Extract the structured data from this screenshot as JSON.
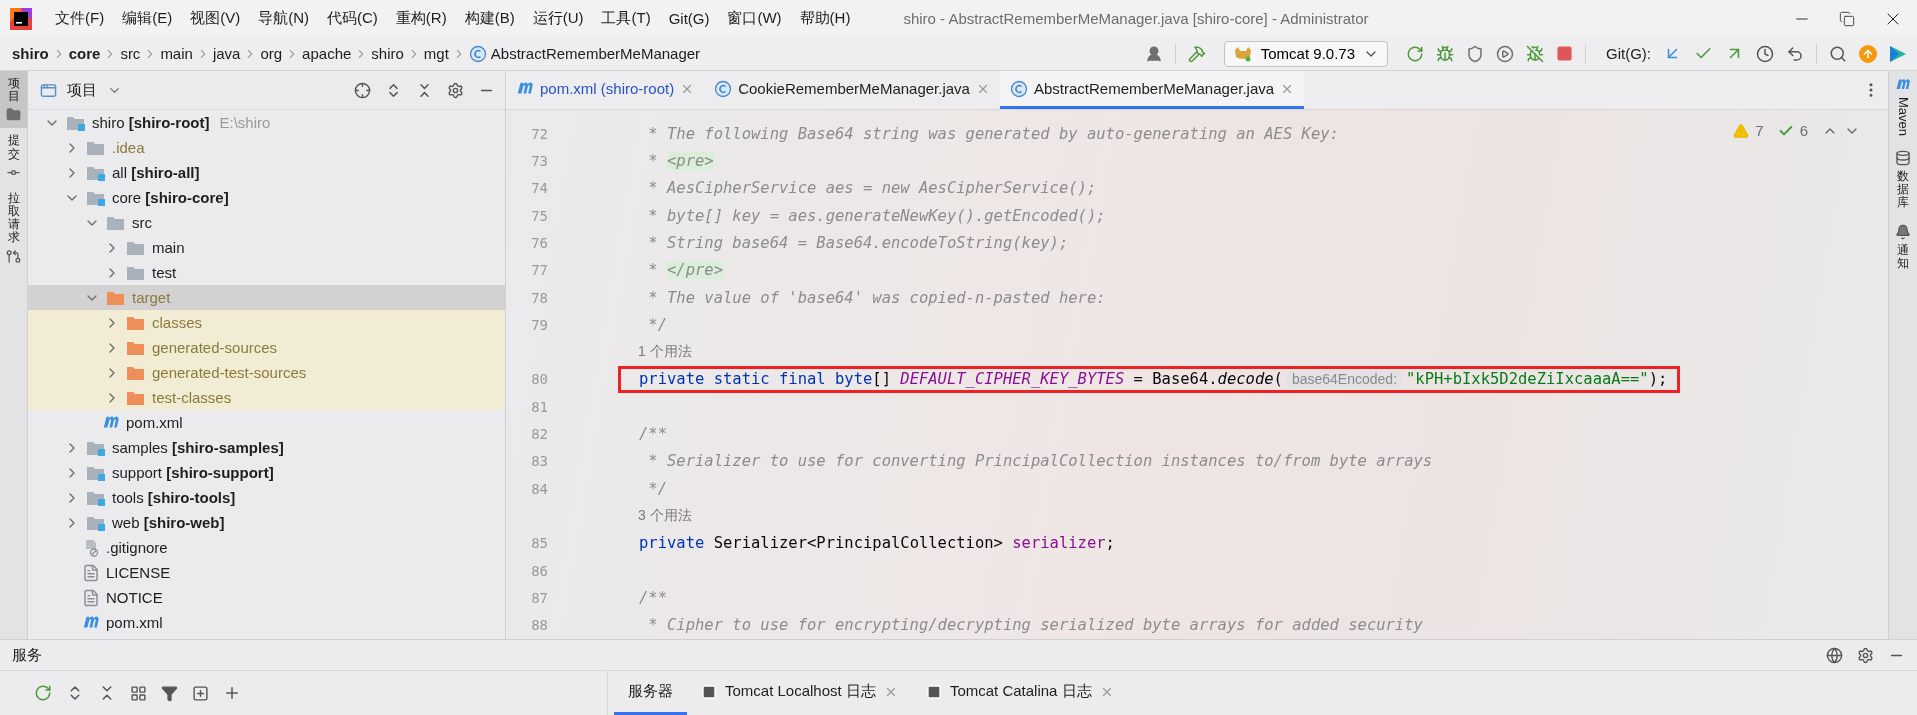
{
  "window": {
    "title": "shiro - AbstractRememberMeManager.java [shiro-core] - Administrator"
  },
  "menu": [
    "文件(F)",
    "编辑(E)",
    "视图(V)",
    "导航(N)",
    "代码(C)",
    "重构(R)",
    "构建(B)",
    "运行(U)",
    "工具(T)",
    "Git(G)",
    "窗口(W)",
    "帮助(H)"
  ],
  "breadcrumb": [
    {
      "label": "shiro",
      "bold": true,
      "kind": "folder"
    },
    {
      "label": "core",
      "bold": true,
      "kind": "folder"
    },
    {
      "label": "src",
      "bold": false,
      "kind": "folder"
    },
    {
      "label": "main",
      "bold": false,
      "kind": "folder"
    },
    {
      "label": "java",
      "bold": false,
      "kind": "folder"
    },
    {
      "label": "org",
      "bold": false,
      "kind": "folder"
    },
    {
      "label": "apache",
      "bold": false,
      "kind": "folder"
    },
    {
      "label": "shiro",
      "bold": false,
      "kind": "folder"
    },
    {
      "label": "mgt",
      "bold": false,
      "kind": "folder"
    },
    {
      "label": "AbstractRememberMeManager",
      "bold": false,
      "kind": "class"
    }
  ],
  "toolbar": {
    "run_config": "Tomcat 9.0.73",
    "git_label": "Git(G):"
  },
  "left_strip": [
    {
      "label": "项目",
      "selected": true,
      "kind": "project"
    },
    {
      "label": "提交",
      "selected": false,
      "kind": "commit"
    },
    {
      "label": "拉取请求",
      "selected": false,
      "kind": "pull"
    }
  ],
  "project": {
    "title": "项目",
    "tree": [
      {
        "name": "shiro",
        "module": "[shiro-root]",
        "path": "E:\\shiro",
        "kind": "module",
        "expanded": true,
        "selected": false,
        "ignored": false,
        "highlighted": false,
        "children": [
          {
            "name": ".idea",
            "kind": "folder",
            "expanded": false,
            "selected": false,
            "ignored": true,
            "highlighted": false
          },
          {
            "name": "all",
            "module": "[shiro-all]",
            "kind": "module",
            "expanded": false,
            "selected": false,
            "ignored": false,
            "highlighted": false
          },
          {
            "name": "core",
            "module": "[shiro-core]",
            "kind": "module",
            "expanded": true,
            "selected": false,
            "ignored": false,
            "highlighted": false,
            "children": [
              {
                "name": "src",
                "kind": "folder",
                "expanded": true,
                "selected": false,
                "ignored": false,
                "highlighted": false,
                "children": [
                  {
                    "name": "main",
                    "kind": "folder",
                    "expanded": false,
                    "selected": false,
                    "ignored": false,
                    "highlighted": false
                  },
                  {
                    "name": "test",
                    "kind": "folder",
                    "expanded": false,
                    "selected": false,
                    "ignored": false,
                    "highlighted": false
                  }
                ]
              },
              {
                "name": "target",
                "kind": "excluded",
                "expanded": true,
                "selected": true,
                "ignored": true,
                "highlighted": false,
                "children": [
                  {
                    "name": "classes",
                    "kind": "excluded",
                    "expanded": false,
                    "selected": false,
                    "ignored": true,
                    "highlighted": true
                  },
                  {
                    "name": "generated-sources",
                    "kind": "excluded",
                    "expanded": false,
                    "selected": false,
                    "ignored": true,
                    "highlighted": true
                  },
                  {
                    "name": "generated-test-sources",
                    "kind": "excluded",
                    "expanded": false,
                    "selected": false,
                    "ignored": true,
                    "highlighted": true
                  },
                  {
                    "name": "test-classes",
                    "kind": "excluded",
                    "expanded": false,
                    "selected": false,
                    "ignored": true,
                    "highlighted": true
                  }
                ]
              },
              {
                "name": "pom.xml",
                "kind": "maven",
                "selected": false,
                "ignored": false,
                "highlighted": false
              }
            ]
          },
          {
            "name": "samples",
            "module": "[shiro-samples]",
            "kind": "module",
            "expanded": false,
            "selected": false,
            "ignored": false,
            "highlighted": false
          },
          {
            "name": "support",
            "module": "[shiro-support]",
            "kind": "module",
            "expanded": false,
            "selected": false,
            "ignored": false,
            "highlighted": false
          },
          {
            "name": "tools",
            "module": "[shiro-tools]",
            "kind": "module",
            "expanded": false,
            "selected": false,
            "ignored": false,
            "highlighted": false
          },
          {
            "name": "web",
            "module": "[shiro-web]",
            "kind": "module",
            "expanded": false,
            "selected": false,
            "ignored": false,
            "highlighted": false
          },
          {
            "name": ".gitignore",
            "kind": "gitignore",
            "selected": false,
            "ignored": false,
            "highlighted": false
          },
          {
            "name": "LICENSE",
            "kind": "text",
            "selected": false,
            "ignored": false,
            "highlighted": false
          },
          {
            "name": "NOTICE",
            "kind": "text",
            "selected": false,
            "ignored": false,
            "highlighted": false
          },
          {
            "name": "pom.xml",
            "kind": "maven",
            "selected": false,
            "ignored": false,
            "highlighted": false
          }
        ]
      }
    ]
  },
  "editor_tabs": [
    {
      "label": "pom.xml (shiro-root)",
      "kind": "maven",
      "selected": false,
      "modified": true
    },
    {
      "label": "CookieRememberMeManager.java",
      "kind": "class",
      "selected": false,
      "modified": false
    },
    {
      "label": "AbstractRememberMeManager.java",
      "kind": "class",
      "selected": true,
      "modified": false
    }
  ],
  "inspections": {
    "warnings": "7",
    "weak_warnings": "6"
  },
  "code": [
    {
      "kind": "code",
      "number": "72",
      "highlighted": false,
      "segments": [
        {
          "kind": "comment",
          "text": " * The following Base64 string was generated by auto-generating an AES Key:"
        }
      ]
    },
    {
      "kind": "code",
      "number": "73",
      "highlighted": false,
      "segments": [
        {
          "kind": "comment",
          "text": " * "
        },
        {
          "kind": "tag",
          "text": "<pre>"
        }
      ]
    },
    {
      "kind": "code",
      "number": "74",
      "highlighted": false,
      "segments": [
        {
          "kind": "comment",
          "text": " * AesCipherService aes = new AesCipherService();"
        }
      ]
    },
    {
      "kind": "code",
      "number": "75",
      "highlighted": false,
      "segments": [
        {
          "kind": "comment",
          "text": " * byte[] key = aes.generateNewKey().getEncoded();"
        }
      ]
    },
    {
      "kind": "code",
      "number": "76",
      "highlighted": false,
      "segments": [
        {
          "kind": "comment",
          "text": " * String base64 = Base64.encodeToString(key);"
        }
      ]
    },
    {
      "kind": "code",
      "number": "77",
      "highlighted": false,
      "segments": [
        {
          "kind": "comment",
          "text": " * "
        },
        {
          "kind": "tag",
          "text": "</pre>"
        }
      ]
    },
    {
      "kind": "code",
      "number": "78",
      "highlighted": false,
      "segments": [
        {
          "kind": "comment",
          "text": " * The value of 'base64' was copied-n-pasted here:"
        }
      ]
    },
    {
      "kind": "code",
      "number": "79",
      "highlighted": false,
      "segments": [
        {
          "kind": "comment",
          "text": " */"
        }
      ]
    },
    {
      "kind": "usages",
      "text": "1 个用法"
    },
    {
      "kind": "code",
      "number": "80",
      "highlighted": true,
      "segments": [
        {
          "kind": "keyword",
          "text": "private static final byte"
        },
        {
          "kind": "plain",
          "text": "[] "
        },
        {
          "kind": "constant",
          "text": "DEFAULT_CIPHER_KEY_BYTES"
        },
        {
          "kind": "plain",
          "text": " = Base64."
        },
        {
          "kind": "method",
          "text": "decode"
        },
        {
          "kind": "plain",
          "text": "("
        },
        {
          "kind": "inlay",
          "text": "base64Encoded:"
        },
        {
          "kind": "string",
          "text": "\"kPH+bIxk5D2deZiIxcaaaA==\""
        },
        {
          "kind": "plain",
          "text": ");"
        }
      ]
    },
    {
      "kind": "code",
      "number": "81",
      "highlighted": false
    },
    {
      "kind": "code",
      "number": "82",
      "highlighted": false,
      "segments": [
        {
          "kind": "comment",
          "text": "/**"
        }
      ]
    },
    {
      "kind": "code",
      "number": "83",
      "highlighted": false,
      "segments": [
        {
          "kind": "comment",
          "text": " * Serializer to use for converting PrincipalCollection instances to/from byte arrays"
        }
      ]
    },
    {
      "kind": "code",
      "number": "84",
      "highlighted": false,
      "segments": [
        {
          "kind": "comment",
          "text": " */"
        }
      ]
    },
    {
      "kind": "usages",
      "text": "3 个用法"
    },
    {
      "kind": "code",
      "number": "85",
      "highlighted": false,
      "segments": [
        {
          "kind": "keyword",
          "text": "private"
        },
        {
          "kind": "plain",
          "text": " Serializer<PrincipalCollection> "
        },
        {
          "kind": "field",
          "text": "serializer"
        },
        {
          "kind": "plain",
          "text": ";"
        }
      ]
    },
    {
      "kind": "code",
      "number": "86",
      "highlighted": false
    },
    {
      "kind": "code",
      "number": "87",
      "highlighted": false,
      "segments": [
        {
          "kind": "comment",
          "text": "/**"
        }
      ]
    },
    {
      "kind": "code",
      "number": "88",
      "highlighted": false,
      "segments": [
        {
          "kind": "comment",
          "text": " * Cipher to use for encrypting/decrypting serialized byte arrays for added security"
        }
      ]
    }
  ],
  "right_strip": [
    {
      "label": "Maven",
      "kind": "maven"
    },
    {
      "label": "数据库",
      "kind": "database"
    },
    {
      "label": "通知",
      "kind": "notifications"
    }
  ],
  "services": {
    "title": "服务",
    "tabs": [
      {
        "label": "服务器",
        "selected": true,
        "kind": "plain",
        "closable": false
      },
      {
        "label": "Tomcat Localhost 日志",
        "selected": false,
        "kind": "console",
        "closable": true
      },
      {
        "label": "Tomcat Catalina 日志",
        "selected": false,
        "kind": "console",
        "closable": true
      }
    ]
  }
}
